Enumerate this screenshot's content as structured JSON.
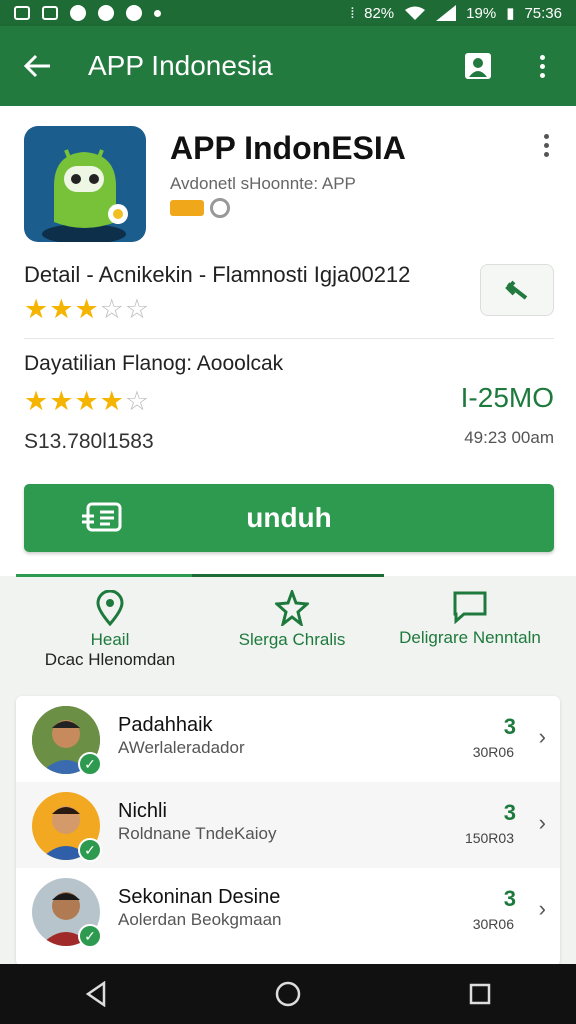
{
  "status_bar": {
    "battery": "19%",
    "time": "75:36",
    "signal_text": "82%"
  },
  "app_bar": {
    "title": "APP Indonesia"
  },
  "app": {
    "name": "APP IndonESIA",
    "subtitle": "Avdonetl sHoonnte: APP",
    "detail": "Detail - Acnikekin - Flamnosti Igja00212",
    "rating_1": 3,
    "subtitle_2": "Dayatilian Flanog: Aooolcak",
    "rating_2": 4,
    "size": "I-25MO",
    "price": "S13.780l1583",
    "time": "49:23 00am"
  },
  "download": {
    "label": "unduh"
  },
  "tabs": [
    {
      "label": "Heail",
      "sub": "Dcac Hlenomdan"
    },
    {
      "label": "Slerga Chralis"
    },
    {
      "label": "Deligrare Nenntaln"
    }
  ],
  "list": [
    {
      "name": "Padahhaik",
      "role": "AWerlaleradador",
      "score": "3",
      "count": "30R06"
    },
    {
      "name": "Nichli",
      "role": "Roldnane TndeKaioy",
      "score": "3",
      "count": "150R03"
    },
    {
      "name": "Sekoninan Desine",
      "role": "Aolerdan Beokgmaan",
      "score": "3",
      "count": "30R06"
    }
  ],
  "colors": {
    "primary": "#237a3f",
    "accent": "#2e9a4f",
    "star": "#f5b400"
  }
}
